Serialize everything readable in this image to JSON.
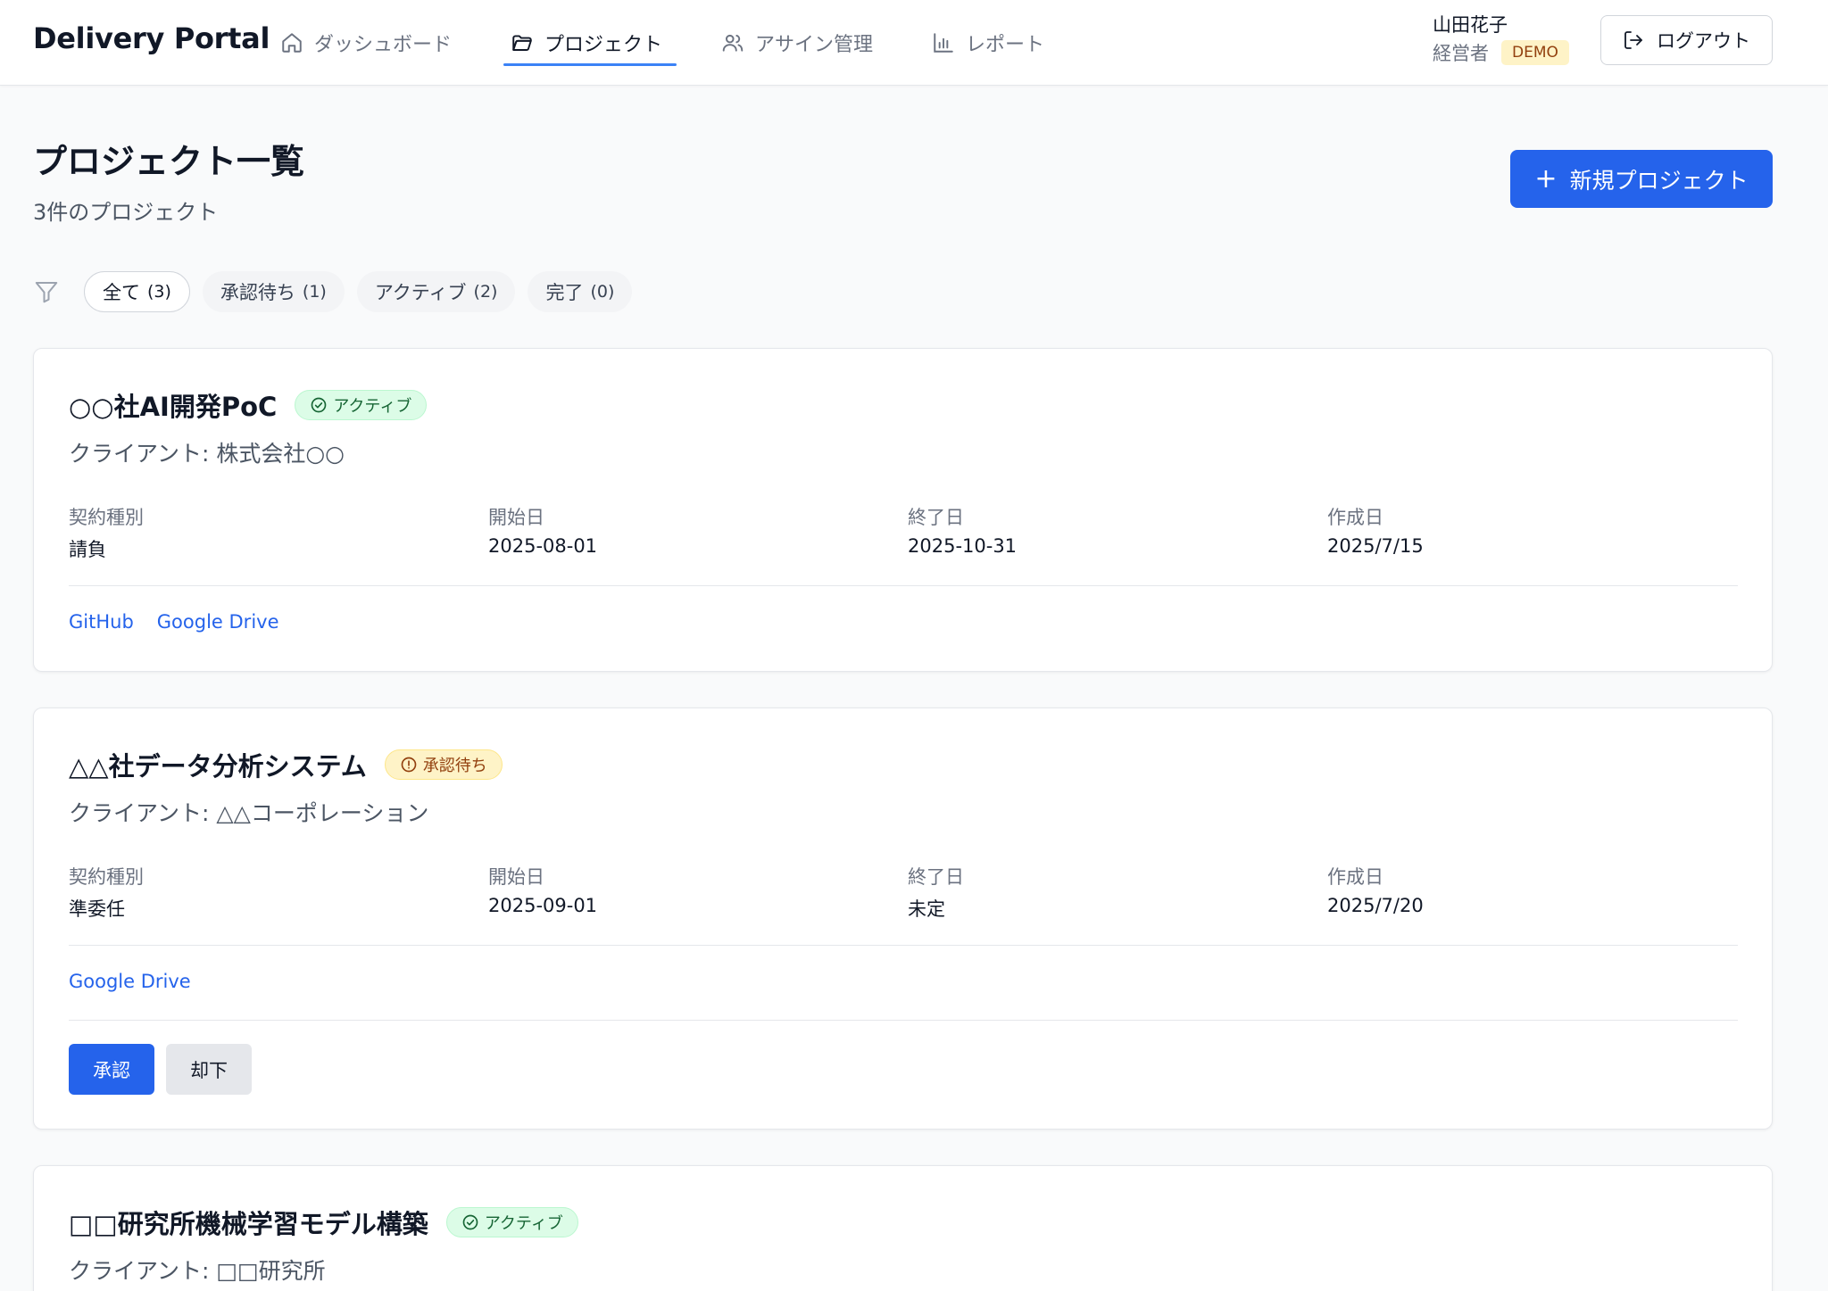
{
  "header": {
    "brand": "Delivery Portal",
    "nav": [
      {
        "label": "ダッシュボード",
        "icon": "home-icon"
      },
      {
        "label": "プロジェクト",
        "icon": "folder-icon",
        "active": true
      },
      {
        "label": "アサイン管理",
        "icon": "users-icon"
      },
      {
        "label": "レポート",
        "icon": "bar-chart-icon"
      }
    ],
    "user_name": "山田花子",
    "user_role": "経営者",
    "demo_badge": "DEMO",
    "logout_label": "ログアウト"
  },
  "page": {
    "title": "プロジェクト一覧",
    "subtitle": "3件のプロジェクト",
    "new_button": "新規プロジェクト"
  },
  "filters": [
    {
      "label": "全て",
      "count": "(3)",
      "active": true
    },
    {
      "label": "承認待ち",
      "count": "(1)"
    },
    {
      "label": "アクティブ",
      "count": "(2)"
    },
    {
      "label": "完了",
      "count": "(0)"
    }
  ],
  "meta_labels": {
    "contract": "契約種別",
    "start": "開始日",
    "end": "終了日",
    "created": "作成日"
  },
  "projects": [
    {
      "title": "○○社AI開発PoC",
      "status": "アクティブ",
      "client": "クライアント: 株式会社○○",
      "contract": "請負",
      "start": "2025-08-01",
      "end": "2025-10-31",
      "created": "2025/7/15",
      "links": [
        "GitHub",
        "Google Drive"
      ]
    },
    {
      "title": "△△社データ分析システム",
      "status": "承認待ち",
      "client": "クライアント: △△コーポレーション",
      "contract": "準委任",
      "start": "2025-09-01",
      "end": "未定",
      "created": "2025/7/20",
      "links": [
        "Google Drive"
      ],
      "approve_label": "承認",
      "reject_label": "却下"
    },
    {
      "title": "□□研究所機械学習モデル構築",
      "status": "アクティブ",
      "client": "クライアント: □□研究所"
    }
  ],
  "colors": {
    "primary": "#2563eb",
    "active_badge_bg": "#dcfce7",
    "pending_badge_bg": "#fef3c7",
    "demo_badge_bg": "#fef3c7"
  }
}
